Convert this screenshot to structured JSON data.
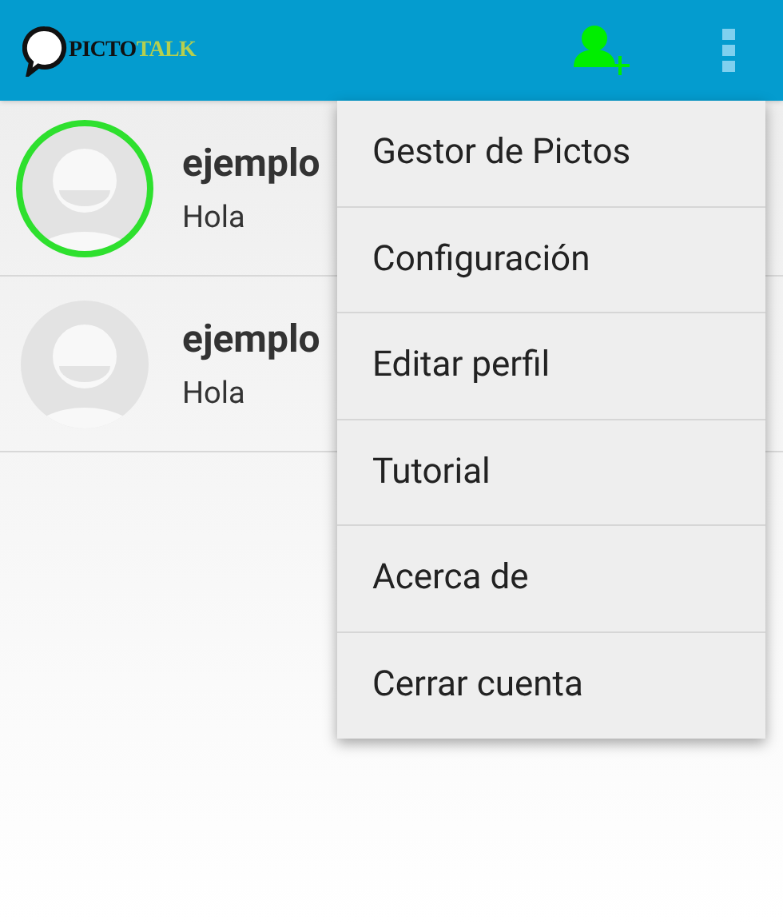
{
  "app_bar": {
    "logo": {
      "part_1": "PICTO",
      "part_2": "TALK"
    }
  },
  "contacts": [
    {
      "name": "ejemplo",
      "message": "Hola",
      "online": true
    },
    {
      "name": "ejemplo",
      "message": "Hola",
      "online": false
    }
  ],
  "menu": {
    "items": [
      "Gestor de Pictos",
      "Configuración",
      "Editar perfil",
      "Tutorial",
      "Acerca de",
      "Cerrar cuenta"
    ]
  }
}
